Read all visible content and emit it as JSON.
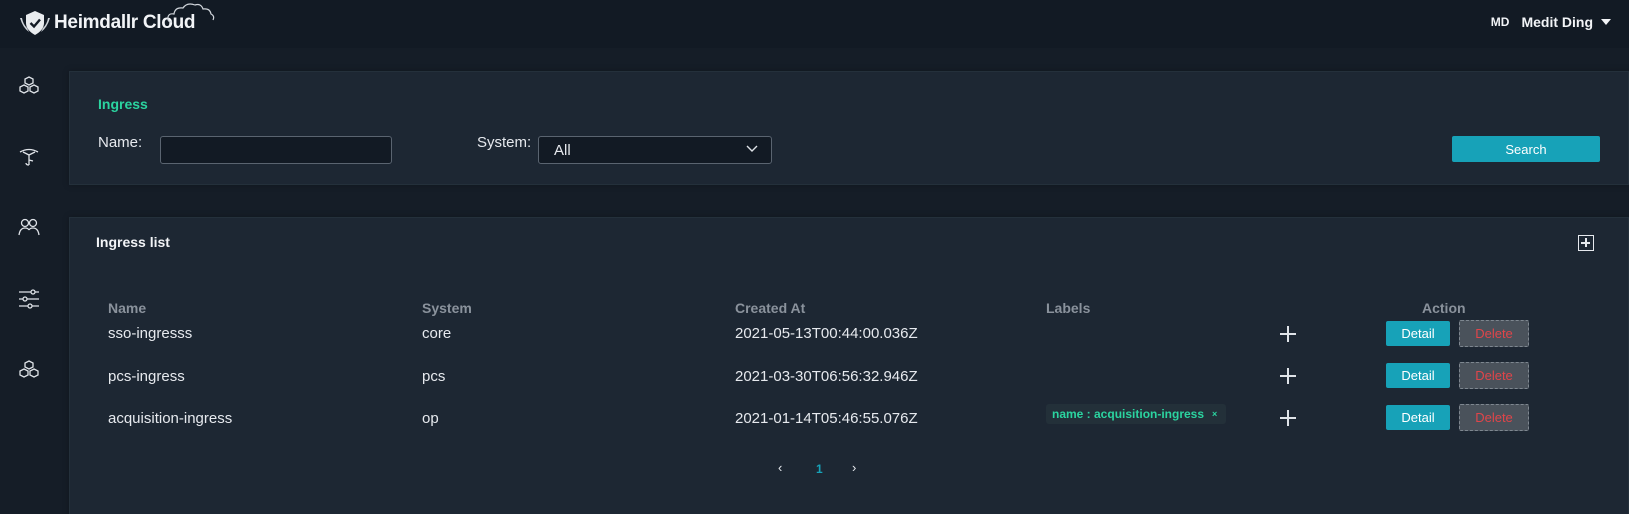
{
  "app": {
    "title": "Heimdallr Cloud"
  },
  "user": {
    "initials": "MD",
    "name": "Medit Ding"
  },
  "sidebar": {
    "items": [
      {
        "icon": "cubes-icon"
      },
      {
        "icon": "network-icon"
      },
      {
        "icon": "users-icon"
      },
      {
        "icon": "sliders-icon"
      },
      {
        "icon": "cubes-icon"
      }
    ]
  },
  "filter": {
    "title": "Ingress",
    "name_label": "Name:",
    "name_value": "",
    "system_label": "System:",
    "system_value": "All",
    "search_label": "Search"
  },
  "list": {
    "title": "Ingress list",
    "columns": {
      "name": "Name",
      "system": "System",
      "created": "Created At",
      "labels": "Labels",
      "action": "Action"
    },
    "rows": [
      {
        "name": "sso-ingresss",
        "system": "core",
        "created": "2021-05-13T00:44:00.036Z",
        "labels": []
      },
      {
        "name": "pcs-ingress",
        "system": "pcs",
        "created": "2021-03-30T06:56:32.946Z",
        "labels": []
      },
      {
        "name": "acquisition-ingress",
        "system": "op",
        "created": "2021-01-14T05:46:55.076Z",
        "labels": [
          "name : acquisition-ingress"
        ]
      }
    ],
    "detail_label": "Detail",
    "delete_label": "Delete",
    "label_remove": "×"
  },
  "pagination": {
    "prev": "‹",
    "page": "1",
    "next": "›"
  },
  "colors": {
    "accent": "#17a2b8",
    "title_green": "#2bd4a0",
    "danger": "#e0454a"
  }
}
